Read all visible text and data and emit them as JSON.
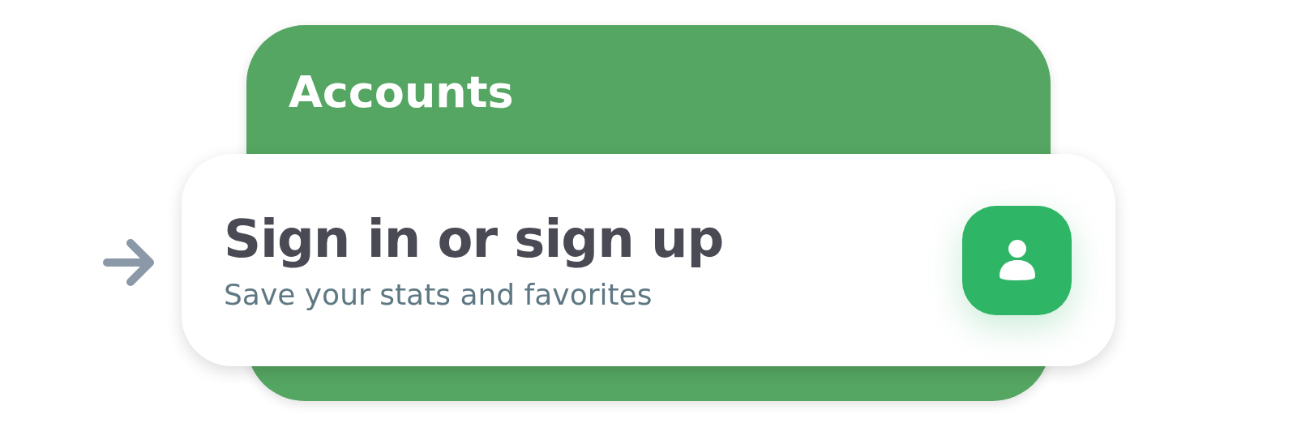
{
  "accounts_panel": {
    "title": "Accounts"
  },
  "sign_in_card": {
    "title": "Sign in or sign up",
    "subtitle": "Save your stats and favorites"
  }
}
